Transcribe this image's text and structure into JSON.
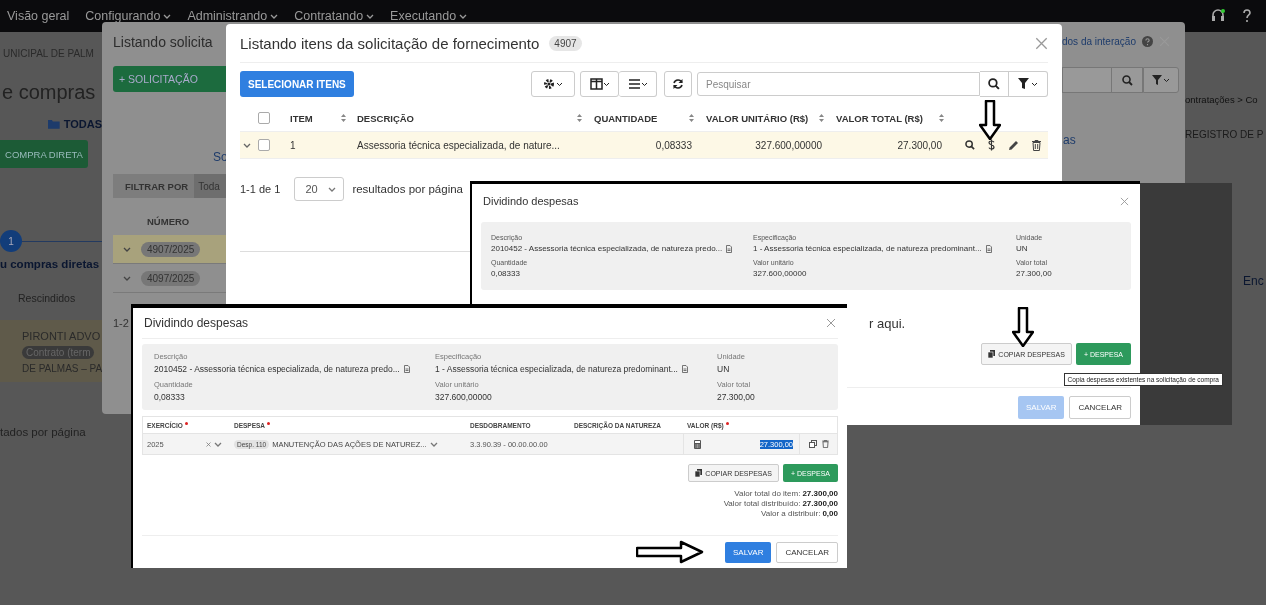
{
  "nav": {
    "items": [
      {
        "label": "Visão geral",
        "has_menu": false
      },
      {
        "label": "Configurando",
        "has_menu": true
      },
      {
        "label": "Administrando",
        "has_menu": true
      },
      {
        "label": "Contratando",
        "has_menu": true
      },
      {
        "label": "Executando",
        "has_menu": true
      }
    ]
  },
  "background_page": {
    "org_name": "UNICIPAL DE PALM",
    "heading": "e compras",
    "folder_tab": "TODAS",
    "direct_purchase_button": "COMPRA DIRETA",
    "step": {
      "number": "1",
      "label": "u compras diretas"
    },
    "status_tab": "Rescindidos",
    "supplier_row": {
      "name": "PIRONTI ADVO",
      "badge": "Contrato (term",
      "city": "DE PALMAS – PA"
    },
    "pagination_label": "tados por página",
    "breadcrumb": "ontratações > Co",
    "register_heading": "REGISTRO DE P",
    "link": "Enc"
  },
  "requests_modal": {
    "title": "Listando solicita",
    "interaction_link": "dos da interação",
    "new_button": "+ SOLICITAÇÃO",
    "link_fragment": "So",
    "link_fragment_right": "as",
    "filter_label": "FILTRAR POR",
    "filter_value": "Toda",
    "column": "NÚMERO",
    "rows": [
      {
        "number": "4907/2025",
        "selected": true
      },
      {
        "number": "4097/2025",
        "selected": false
      }
    ],
    "range": "1-2"
  },
  "items_modal": {
    "title": "Listando itens da solicitação de fornecimento",
    "count": "4907",
    "select_button": "SELECIONAR ITENS",
    "search": {
      "placeholder": "Pesquisar"
    },
    "columns": [
      "ITEM",
      "DESCRIÇÃO",
      "QUANTIDADE",
      "VALOR UNITÁRIO (R$)",
      "VALOR TOTAL (R$)"
    ],
    "all_checked": false,
    "rows": [
      {
        "item": "1",
        "description": "Assessoria técnica especializada, de nature...",
        "quantity": "0,08333",
        "unit_value": "327.600,00000",
        "total_value": "27.300,00",
        "checked": false,
        "expanded": false,
        "selected": true
      }
    ],
    "range": "1-1 de 1",
    "page_size": "20",
    "page_size_label": "resultados por página"
  },
  "split_dialog_back": {
    "title": "Dividindo despesas",
    "fields": [
      {
        "label": "Descrição",
        "value": "2010452 - Assessoria técnica especializada, de natureza predo...",
        "has_note": true
      },
      {
        "label": "Especificação",
        "value": "1 - Assessoria técnica especializada, de natureza predominant...",
        "has_note": true
      },
      {
        "label": "Unidade",
        "value": "UN",
        "has_note": false
      },
      {
        "label": "Quantidade",
        "value": "0,08333",
        "has_note": false
      },
      {
        "label": "Valor unitário",
        "value": "327.600,00000",
        "has_note": false
      },
      {
        "label": "Valor total",
        "value": "27.300,00",
        "has_note": false
      }
    ],
    "behind_text": "r aqui.",
    "copy_button": "COPIAR DESPESAS",
    "add_button": "+ DESPESA",
    "tooltip": "Copia despesas existentes na solicitação de compra",
    "save_button": {
      "label": "SALVAR",
      "disabled": true
    },
    "cancel_button": "CANCELAR"
  },
  "split_dialog_front": {
    "title": "Dividindo despesas",
    "fields": [
      {
        "label": "Descrição",
        "value": "2010452 - Assessoria técnica especializada, de natureza predo...",
        "has_note": true
      },
      {
        "label": "Especificação",
        "value": "1 - Assessoria técnica especializada, de natureza predominant...",
        "has_note": true
      },
      {
        "label": "Unidade",
        "value": "UN",
        "has_note": false
      },
      {
        "label": "Quantidade",
        "value": "0,08333",
        "has_note": false
      },
      {
        "label": "Valor unitário",
        "value": "327.600,00000",
        "has_note": false
      },
      {
        "label": "Valor total",
        "value": "27.300,00",
        "has_note": false
      }
    ],
    "table": {
      "columns": [
        {
          "label": "EXERCÍCIO",
          "required": true
        },
        {
          "label": "DESPESA",
          "required": true
        },
        {
          "label": "DESDOBRAMENTO",
          "required": false
        },
        {
          "label": "DESCRIÇÃO DA NATUREZA",
          "required": false
        },
        {
          "label": "VALOR (R$)",
          "required": true
        }
      ],
      "rows": [
        {
          "year": "2025",
          "expense_tag": "Desp. 110",
          "expense": "MANUTENÇÃO DAS AÇÕES DE NATUREZ...",
          "breakdown": "3.3.90.39 - 00.00.00.00",
          "value": "27.300,00",
          "value_selected": true
        }
      ]
    },
    "copy_button": "COPIAR DESPESAS",
    "add_button": "+ DESPESA",
    "totals": [
      {
        "label": "Valor total do item:",
        "value": "27.300,00"
      },
      {
        "label": "Valor total distribuído:",
        "value": "27.300,00"
      },
      {
        "label": "Valor a distribuir:",
        "value": "0,00"
      }
    ],
    "save_button": {
      "label": "SALVAR",
      "disabled": false
    },
    "cancel_button": "CANCELAR"
  }
}
